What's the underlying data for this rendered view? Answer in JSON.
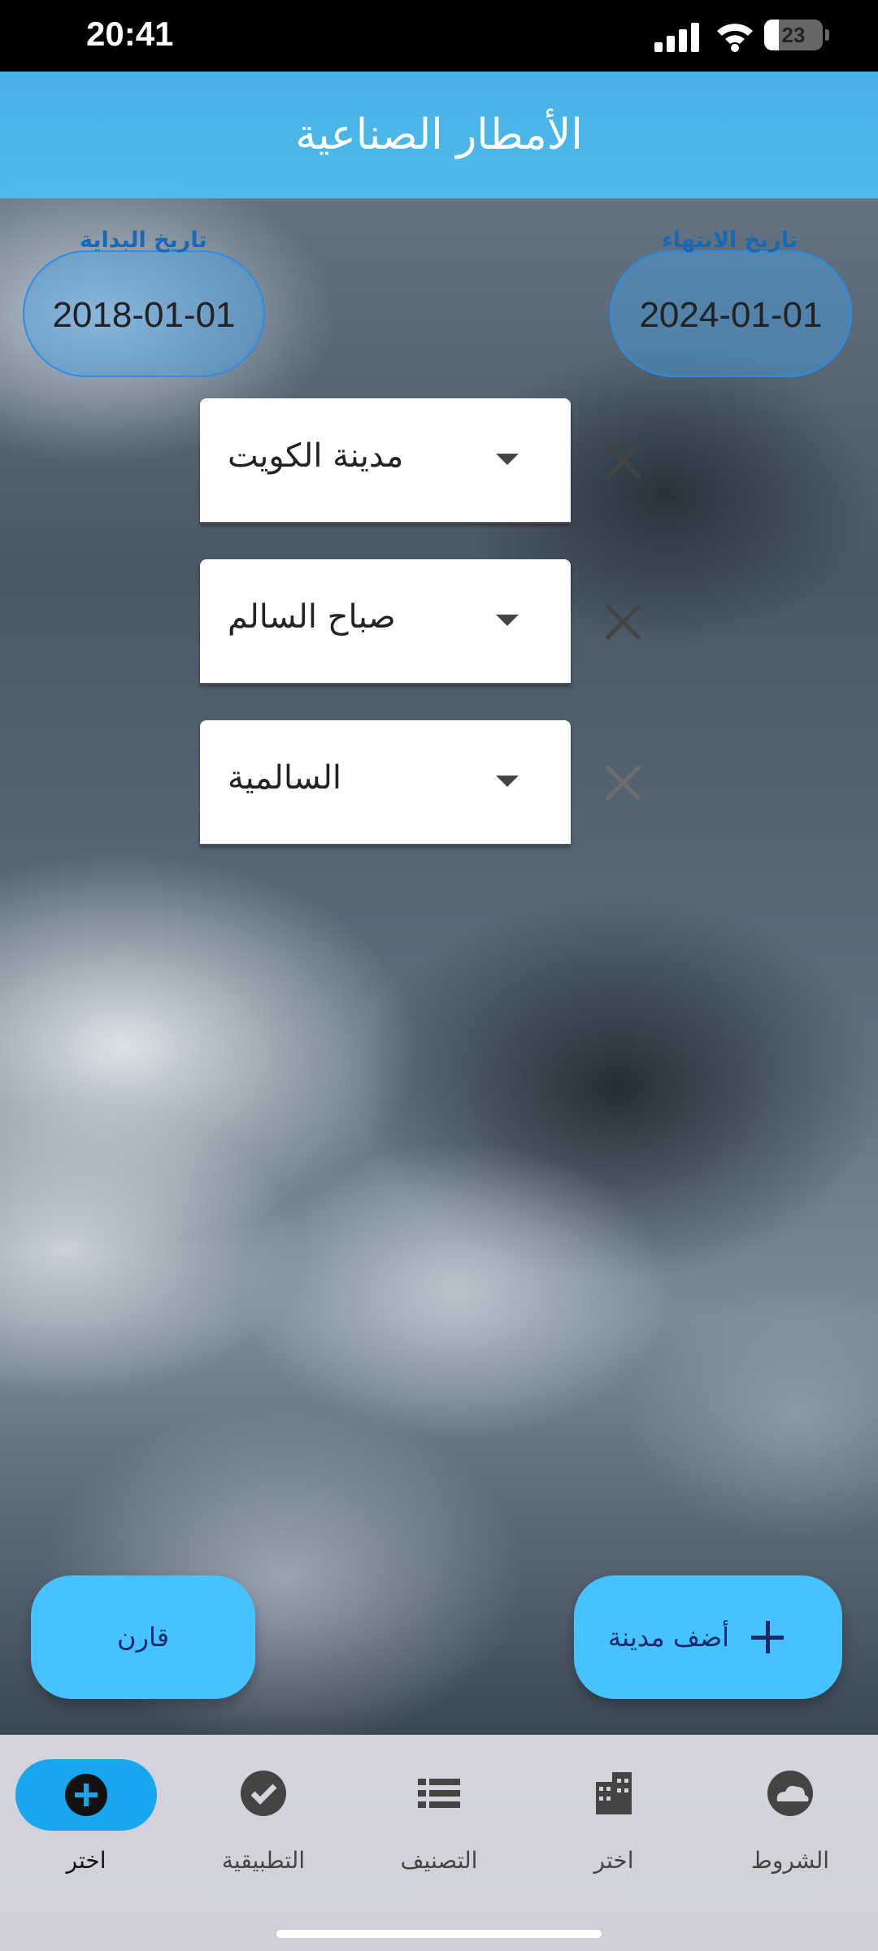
{
  "status_bar": {
    "time": "20:41",
    "battery": "23"
  },
  "app_bar": {
    "title": "الأمطار الصناعية"
  },
  "dates": {
    "start": {
      "label": "تاريخ البداية",
      "value": "2018-01-01"
    },
    "end": {
      "label": "تاريخ الانتهاء",
      "value": "2024-01-01"
    }
  },
  "cities": [
    {
      "name": "مدينة الكويت"
    },
    {
      "name": "صباح السالم"
    },
    {
      "name": "السالمية"
    }
  ],
  "buttons": {
    "compare": "قارن",
    "add_city": "أضف مدينة"
  },
  "bottom_nav": {
    "items": [
      {
        "label": "الشروط",
        "icon": "cloud-icon"
      },
      {
        "label": "اختر",
        "icon": "building-icon"
      },
      {
        "label": "التصنيف",
        "icon": "list-icon"
      },
      {
        "label": "التطبيقية",
        "icon": "check-circle-icon"
      },
      {
        "label": "اختر",
        "icon": "add-circle-icon"
      }
    ]
  },
  "colors": {
    "accent": "#45c2ff",
    "appbar": "#4bbef0",
    "nav_active": "#18a6ee"
  }
}
